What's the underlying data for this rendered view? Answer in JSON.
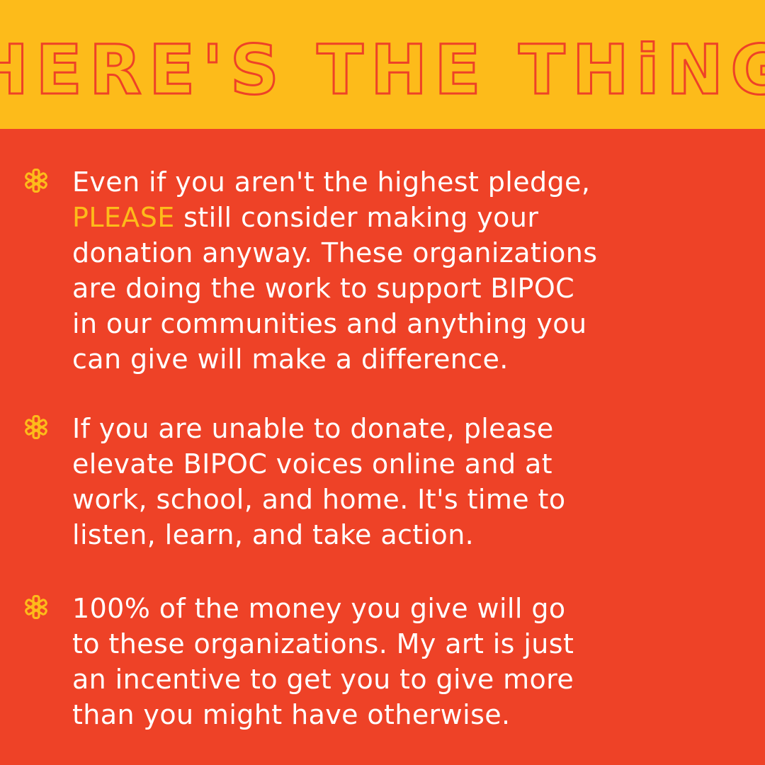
{
  "colors": {
    "header_background": "#fdbb1a",
    "header_text": "#ee4227",
    "body_background": "#ee4227",
    "body_text": "#ffffff",
    "highlight": "#fdbb1a"
  },
  "header": {
    "title": "HERE'S THE THiNG"
  },
  "bullets": [
    {
      "icon": "asterisk-icon",
      "lines": [
        "Even if you aren't the highest pledge,",
        "still consider making your",
        "donation anyway. These organizations",
        "are doing the work to support BIPOC",
        "in our communities and anything you",
        "can give will make a difference."
      ],
      "highlight_word": "PLEASE"
    },
    {
      "icon": "asterisk-icon",
      "lines": [
        "If you are unable to donate, please",
        "elevate BIPOC voices online and at",
        "work, school, and home. It's time to",
        "listen, learn, and take action."
      ]
    },
    {
      "icon": "asterisk-icon",
      "lines": [
        "100% of the money you give will go",
        "to these organizations. My art is just",
        "an incentive to get you to give more",
        "than you might have otherwise."
      ]
    }
  ]
}
